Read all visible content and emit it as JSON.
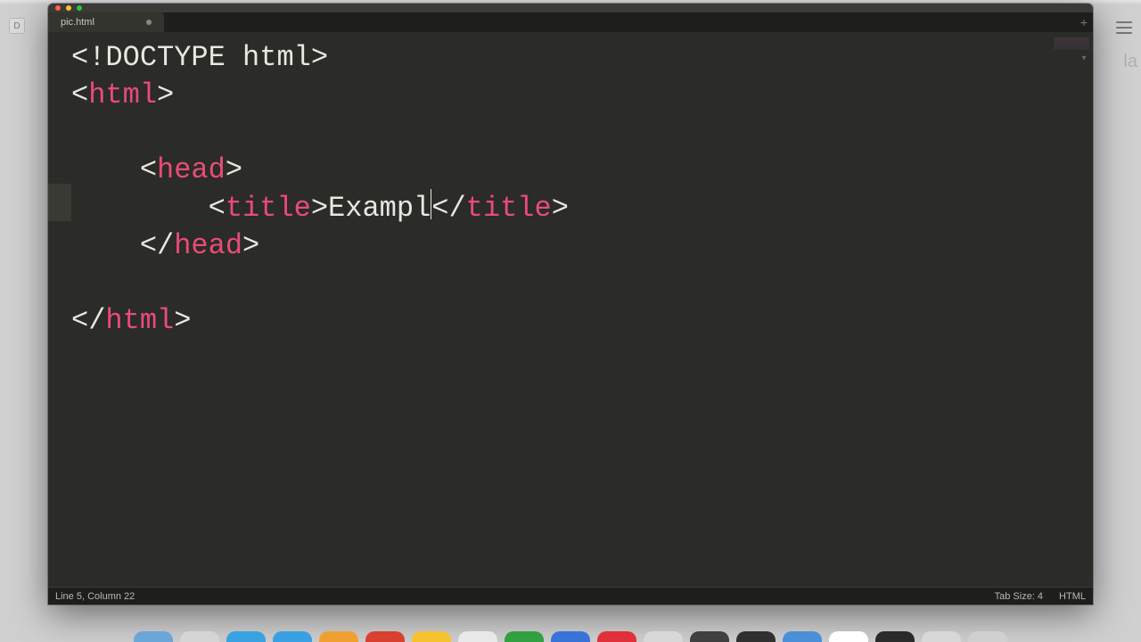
{
  "tab": {
    "filename": "pic.html",
    "dirty": true
  },
  "code": {
    "l1_doctype": "<!DOCTYPE html>",
    "tag_html": "html",
    "tag_head": "head",
    "tag_title": "title",
    "title_text": "Exampl"
  },
  "status": {
    "position": "Line 5, Column 22",
    "tabsize": "Tab Size: 4",
    "syntax": "HTML"
  },
  "bg": {
    "btn": "D",
    "peek": "la"
  },
  "tabadd": "+",
  "tabdrop": "▾",
  "dock_colors": [
    "#6aa6d8",
    "#d5d5d5",
    "#38a3e0",
    "#3aa0e4",
    "#f0a030",
    "#d84030",
    "#f6c230",
    "#e8e8e8",
    "#30a040",
    "#3874d8",
    "#e0303a",
    "#d8d8d8",
    "#404040",
    "#303030",
    "#4a8fd8",
    "#ffffff",
    "#2a2a2a",
    "#d8d8d8",
    "#d0d0d0"
  ]
}
